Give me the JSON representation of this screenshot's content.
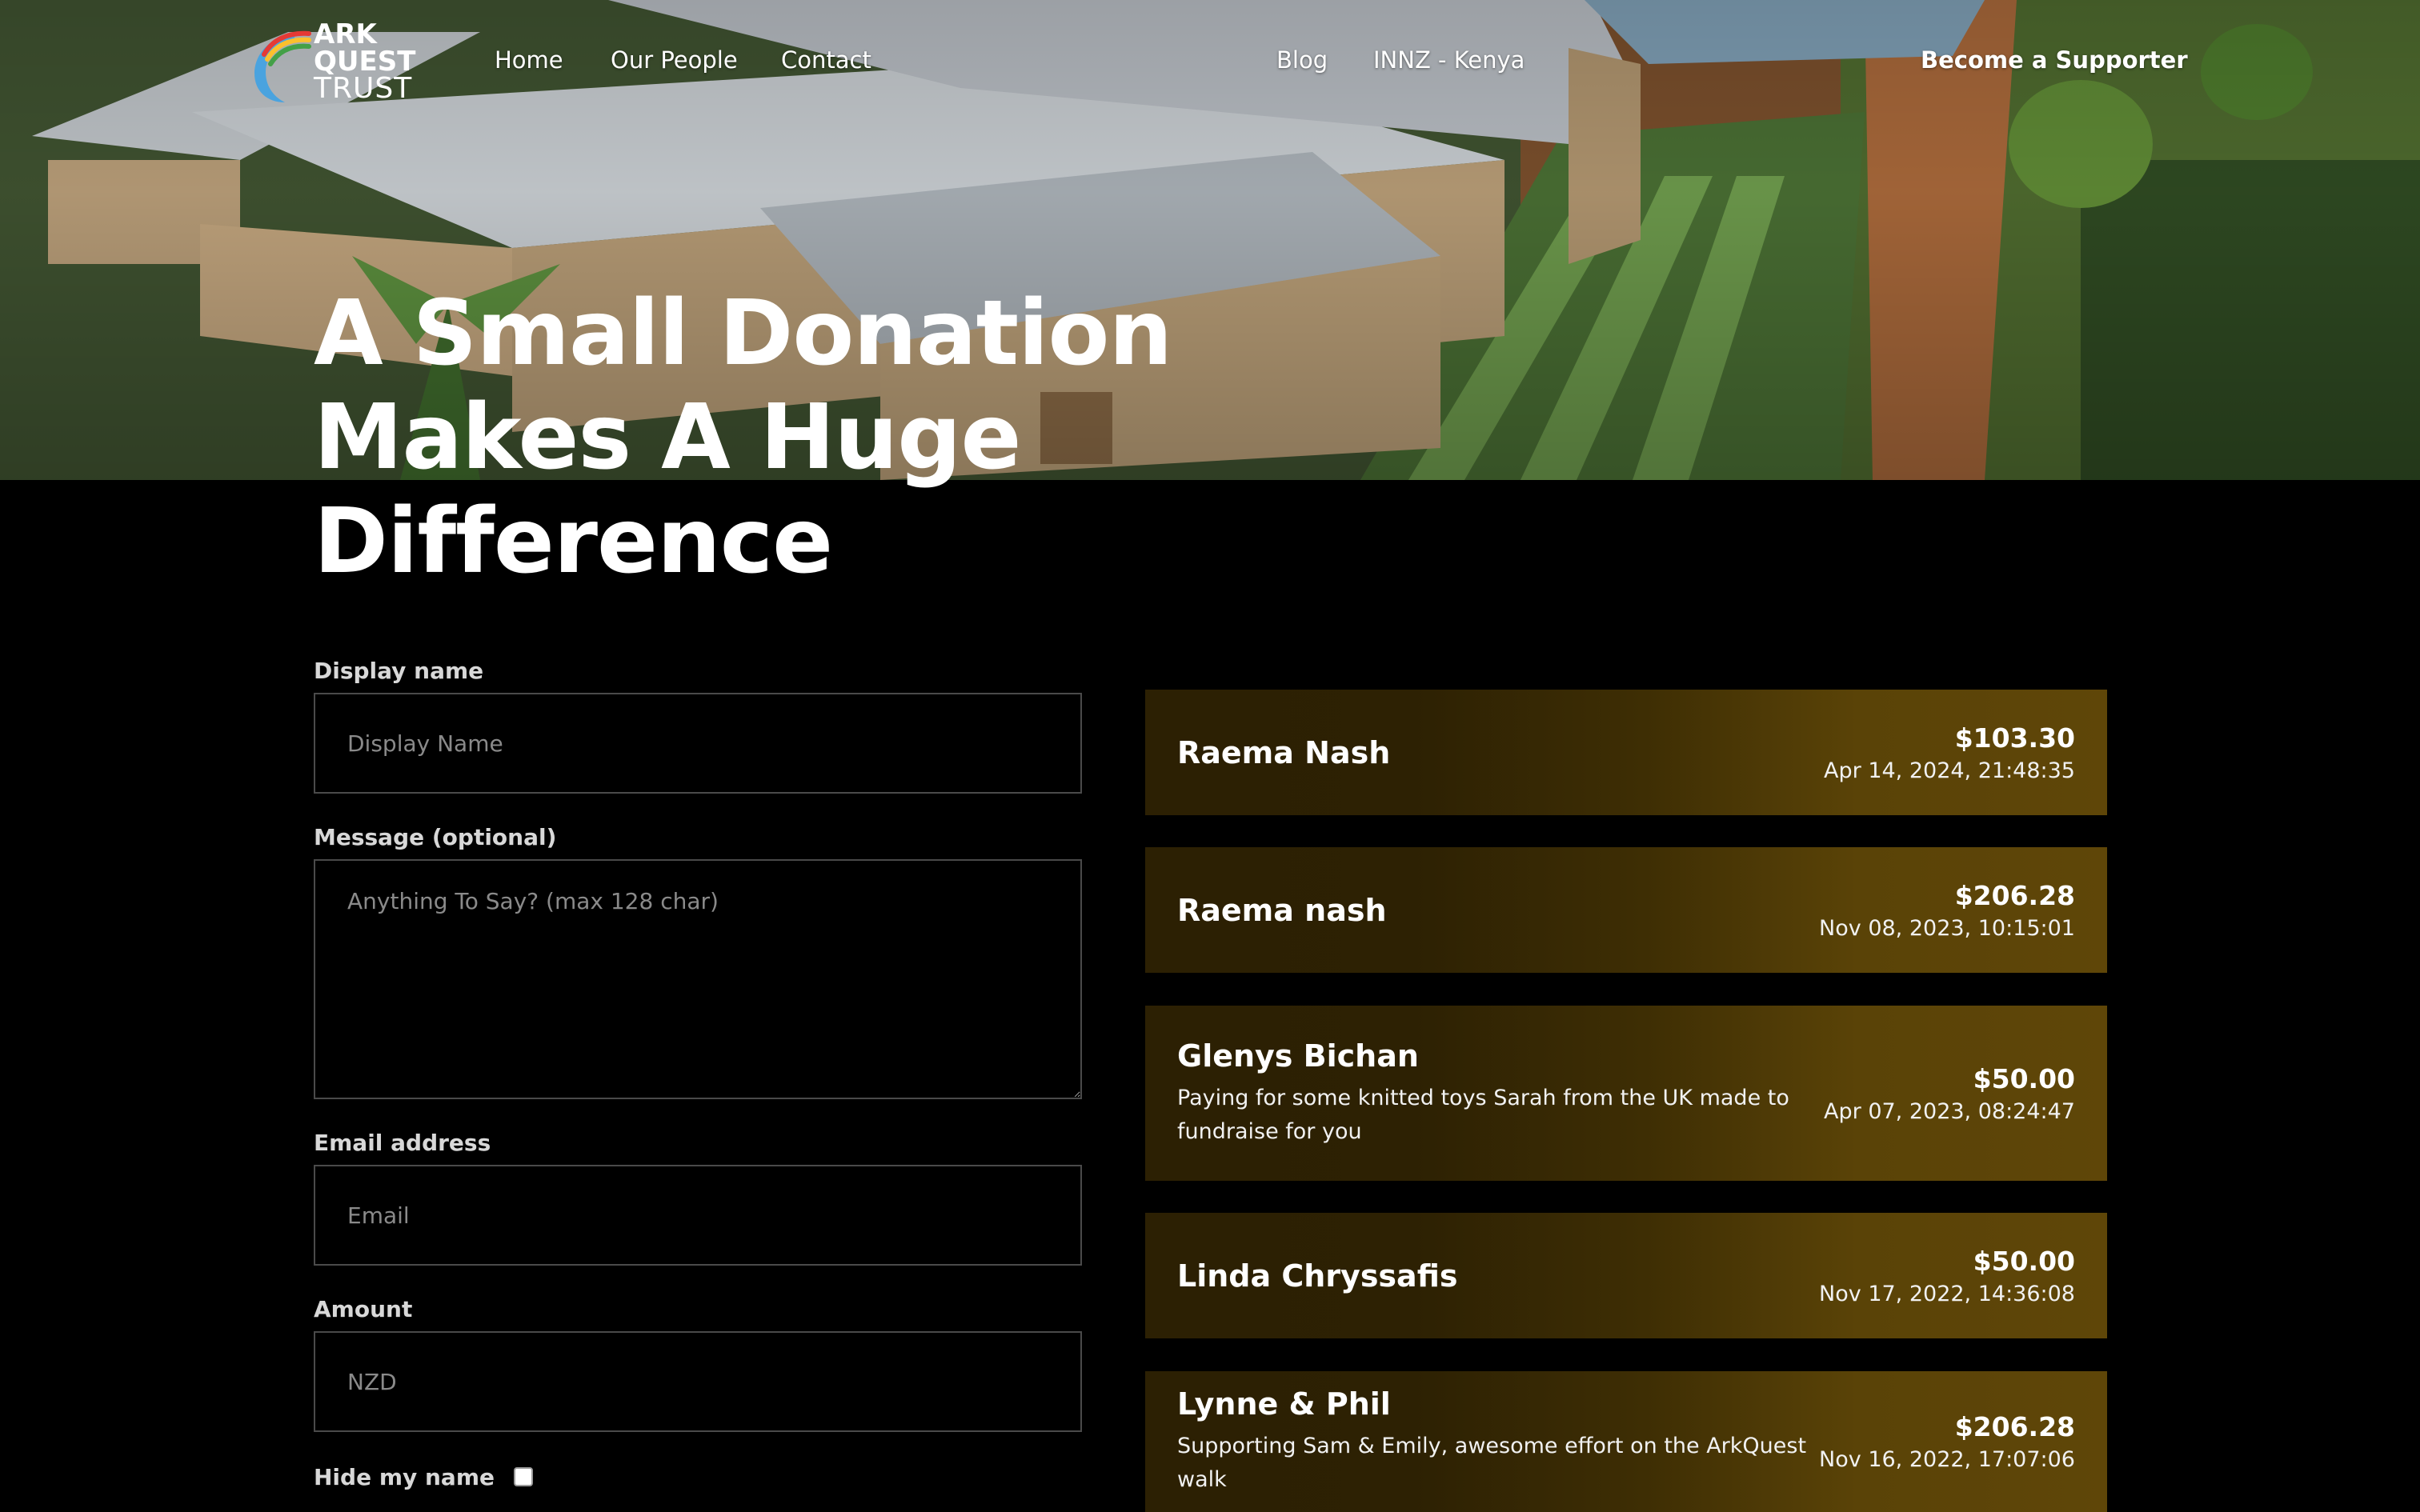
{
  "brand": {
    "name_line1": "ARK",
    "name_line2": "QUEST",
    "name_line3": "TRUST",
    "logo_icon": "rainbow-swoosh-icon",
    "colors": {
      "rainbow": [
        "#e53935",
        "#fbc02d",
        "#43a047"
      ],
      "swoosh": "#4aa3df"
    }
  },
  "nav": {
    "home": "Home",
    "our_people": "Our People",
    "contact": "Contact",
    "blog": "Blog",
    "innz_kenya": "INNZ - Kenya",
    "cta": "Become a Supporter"
  },
  "hero": {
    "headline_line1": "A Small Donation",
    "headline_line2": "Makes A Huge",
    "headline_line3": "Difference"
  },
  "form": {
    "display_name": {
      "label": "Display name",
      "placeholder": "Display Name",
      "value": ""
    },
    "message": {
      "label": "Message (optional)",
      "placeholder": "Anything To Say? (max 128 char)",
      "value": ""
    },
    "email": {
      "label": "Email address",
      "placeholder": "Email",
      "value": ""
    },
    "amount": {
      "label": "Amount",
      "placeholder": "NZD",
      "value": ""
    },
    "hide_name": {
      "label": "Hide my name",
      "checked": false
    }
  },
  "donations": [
    {
      "name": "Raema Nash",
      "message": "",
      "amount": "$103.30",
      "date": "Apr 14, 2024, 21:48:35"
    },
    {
      "name": "Raema nash",
      "message": "",
      "amount": "$206.28",
      "date": "Nov 08, 2023, 10:15:01"
    },
    {
      "name": "Glenys Bichan",
      "message": "Paying for some knitted toys Sarah from the UK made to fundraise for you",
      "amount": "$50.00",
      "date": "Apr 07, 2023, 08:24:47"
    },
    {
      "name": "Linda Chryssafis",
      "message": "",
      "amount": "$50.00",
      "date": "Nov 17, 2022, 14:36:08"
    },
    {
      "name": "Lynne & Phil",
      "message": "Supporting Sam & Emily, awesome effort on the ArkQuest walk",
      "amount": "$206.28",
      "date": "Nov 16, 2022, 17:07:06"
    }
  ],
  "theme": {
    "background": "#000000",
    "card_gradient_start": "#2c2003",
    "card_gradient_end": "#5f4608",
    "input_border": "#4a4a4a"
  }
}
